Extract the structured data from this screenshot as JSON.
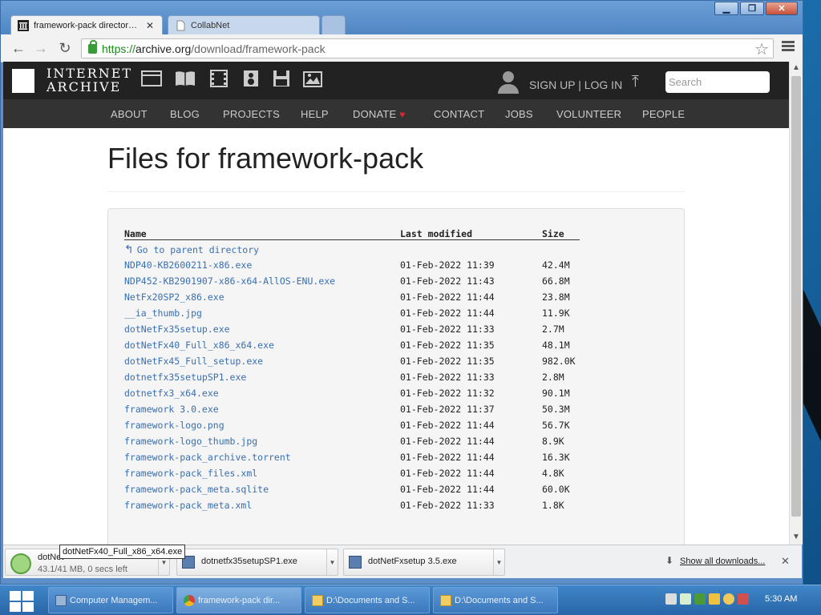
{
  "browser": {
    "tabs": [
      {
        "label": "framework-pack directory lis",
        "active": true
      },
      {
        "label": "CollabNet",
        "active": false
      }
    ],
    "url": {
      "scheme": "https://",
      "host": "archive.org",
      "path": "/download/framework-pack"
    }
  },
  "ia": {
    "logo_line1": "INTERNET",
    "logo_line2": "ARCHIVE",
    "signin": "SIGN UP | LOG IN",
    "search_placeholder": "Search",
    "nav": [
      "ABOUT",
      "BLOG",
      "PROJECTS",
      "HELP",
      "DONATE",
      "CONTACT",
      "JOBS",
      "VOLUNTEER",
      "PEOPLE"
    ]
  },
  "page": {
    "title": "Files for framework-pack",
    "columns": {
      "name": "Name",
      "modified": "Last modified",
      "size": "Size"
    },
    "parent_link": "Go to parent directory",
    "files": [
      {
        "name": "NDP40-KB2600211-x86.exe",
        "modified": "01-Feb-2022 11:39",
        "size": "42.4M"
      },
      {
        "name": "NDP452-KB2901907-x86-x64-AllOS-ENU.exe",
        "modified": "01-Feb-2022 11:43",
        "size": "66.8M"
      },
      {
        "name": "NetFx20SP2_x86.exe",
        "modified": "01-Feb-2022 11:44",
        "size": "23.8M"
      },
      {
        "name": "__ia_thumb.jpg",
        "modified": "01-Feb-2022 11:44",
        "size": "11.9K"
      },
      {
        "name": "dotNetFx35setup.exe",
        "modified": "01-Feb-2022 11:33",
        "size": "2.7M"
      },
      {
        "name": "dotNetFx40_Full_x86_x64.exe",
        "modified": "01-Feb-2022 11:35",
        "size": "48.1M"
      },
      {
        "name": "dotNetFx45_Full_setup.exe",
        "modified": "01-Feb-2022 11:35",
        "size": "982.0K"
      },
      {
        "name": "dotnetfx35setupSP1.exe",
        "modified": "01-Feb-2022 11:33",
        "size": "2.8M"
      },
      {
        "name": "dotnetfx3_x64.exe",
        "modified": "01-Feb-2022 11:32",
        "size": "90.1M"
      },
      {
        "name": "framework 3.0.exe",
        "modified": "01-Feb-2022 11:37",
        "size": "50.3M"
      },
      {
        "name": "framework-logo.png",
        "modified": "01-Feb-2022 11:44",
        "size": "56.7K"
      },
      {
        "name": "framework-logo_thumb.jpg",
        "modified": "01-Feb-2022 11:44",
        "size": "8.9K"
      },
      {
        "name": "framework-pack_archive.torrent",
        "modified": "01-Feb-2022 11:44",
        "size": "16.3K"
      },
      {
        "name": "framework-pack_files.xml",
        "modified": "01-Feb-2022 11:44",
        "size": "4.8K"
      },
      {
        "name": "framework-pack_meta.sqlite",
        "modified": "01-Feb-2022 11:44",
        "size": "60.0K"
      },
      {
        "name": "framework-pack_meta.xml",
        "modified": "01-Feb-2022 11:33",
        "size": "1.8K"
      }
    ]
  },
  "downloads": {
    "items": [
      {
        "name": "dotNet",
        "status": "43.1/4",
        "status_suffix": "1 MB, 0 secs left",
        "in_progress": true
      },
      {
        "name": "dotnetfx35setupSP1.exe"
      },
      {
        "name": "dotNetFxsetup 3.5.exe"
      }
    ],
    "tooltip": "dotNetFx40_Full_x86_x64.exe",
    "show_all": "Show all downloads..."
  },
  "taskbar": {
    "tasks": [
      {
        "label": "Computer Managem...",
        "active": false
      },
      {
        "label": "framework-pack dir...",
        "active": true
      },
      {
        "label": "D:\\Documents and S...",
        "active": false
      },
      {
        "label": "D:\\Documents and S...",
        "active": false
      }
    ],
    "clock": "5:30 AM"
  }
}
